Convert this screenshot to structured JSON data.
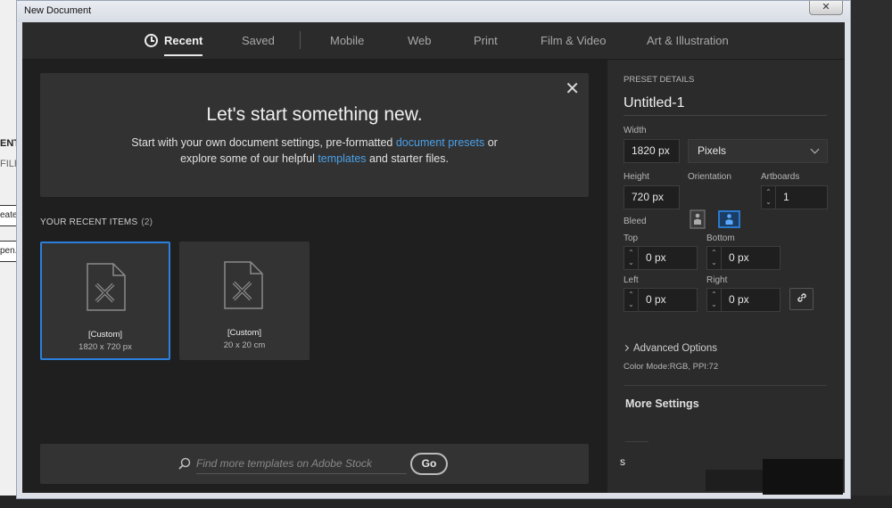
{
  "window": {
    "title": "New Document",
    "close_glyph": "✕"
  },
  "tabs": [
    {
      "label": "Recent",
      "active": true,
      "icon": "clock-icon"
    },
    {
      "label": "Saved"
    },
    {
      "label": "Mobile"
    },
    {
      "label": "Web"
    },
    {
      "label": "Print"
    },
    {
      "label": "Film & Video"
    },
    {
      "label": "Art & Illustration"
    }
  ],
  "hero": {
    "heading": "Let's start something new.",
    "line1_pre": "Start with your own document settings, pre-formatted ",
    "line1_link": "document presets",
    "line1_post": " or",
    "line2_pre": "explore some of our helpful ",
    "line2_link": "templates",
    "line2_post": " and starter files.",
    "close_glyph": "✕",
    "link_color": "#4ba0e8"
  },
  "recent": {
    "label": "YOUR RECENT ITEMS",
    "count": "(2)",
    "items": [
      {
        "name": "[Custom]",
        "size": "1820 x 720 px",
        "selected": true
      },
      {
        "name": "[Custom]",
        "size": "20 x 20 cm",
        "selected": false
      }
    ]
  },
  "search": {
    "placeholder": "Find more templates on Adobe Stock",
    "go_label": "Go"
  },
  "preset": {
    "section_label": "PRESET DETAILS",
    "name": "Untitled-1",
    "width_label": "Width",
    "width_value": "1820 px",
    "units": "Pixels",
    "height_label": "Height",
    "height_value": "720 px",
    "orientation_label": "Orientation",
    "artboards_label": "Artboards",
    "artboards_value": "1",
    "bleed_label": "Bleed",
    "top_label": "Top",
    "top_value": "0 px",
    "bottom_label": "Bottom",
    "bottom_value": "0 px",
    "left_label": "Left",
    "left_value": "0 px",
    "right_label": "Right",
    "right_value": "0 px",
    "advanced_label": "Advanced Options",
    "color_mode": "Color Mode:RGB, PPI:72",
    "more_settings": "More Settings",
    "accent": "#2b80dd"
  },
  "background": {
    "left_labels": [
      "ENT",
      "FILE"
    ],
    "left_buttons": [
      "eate",
      "pen.."
    ],
    "bottom_text": "s"
  }
}
